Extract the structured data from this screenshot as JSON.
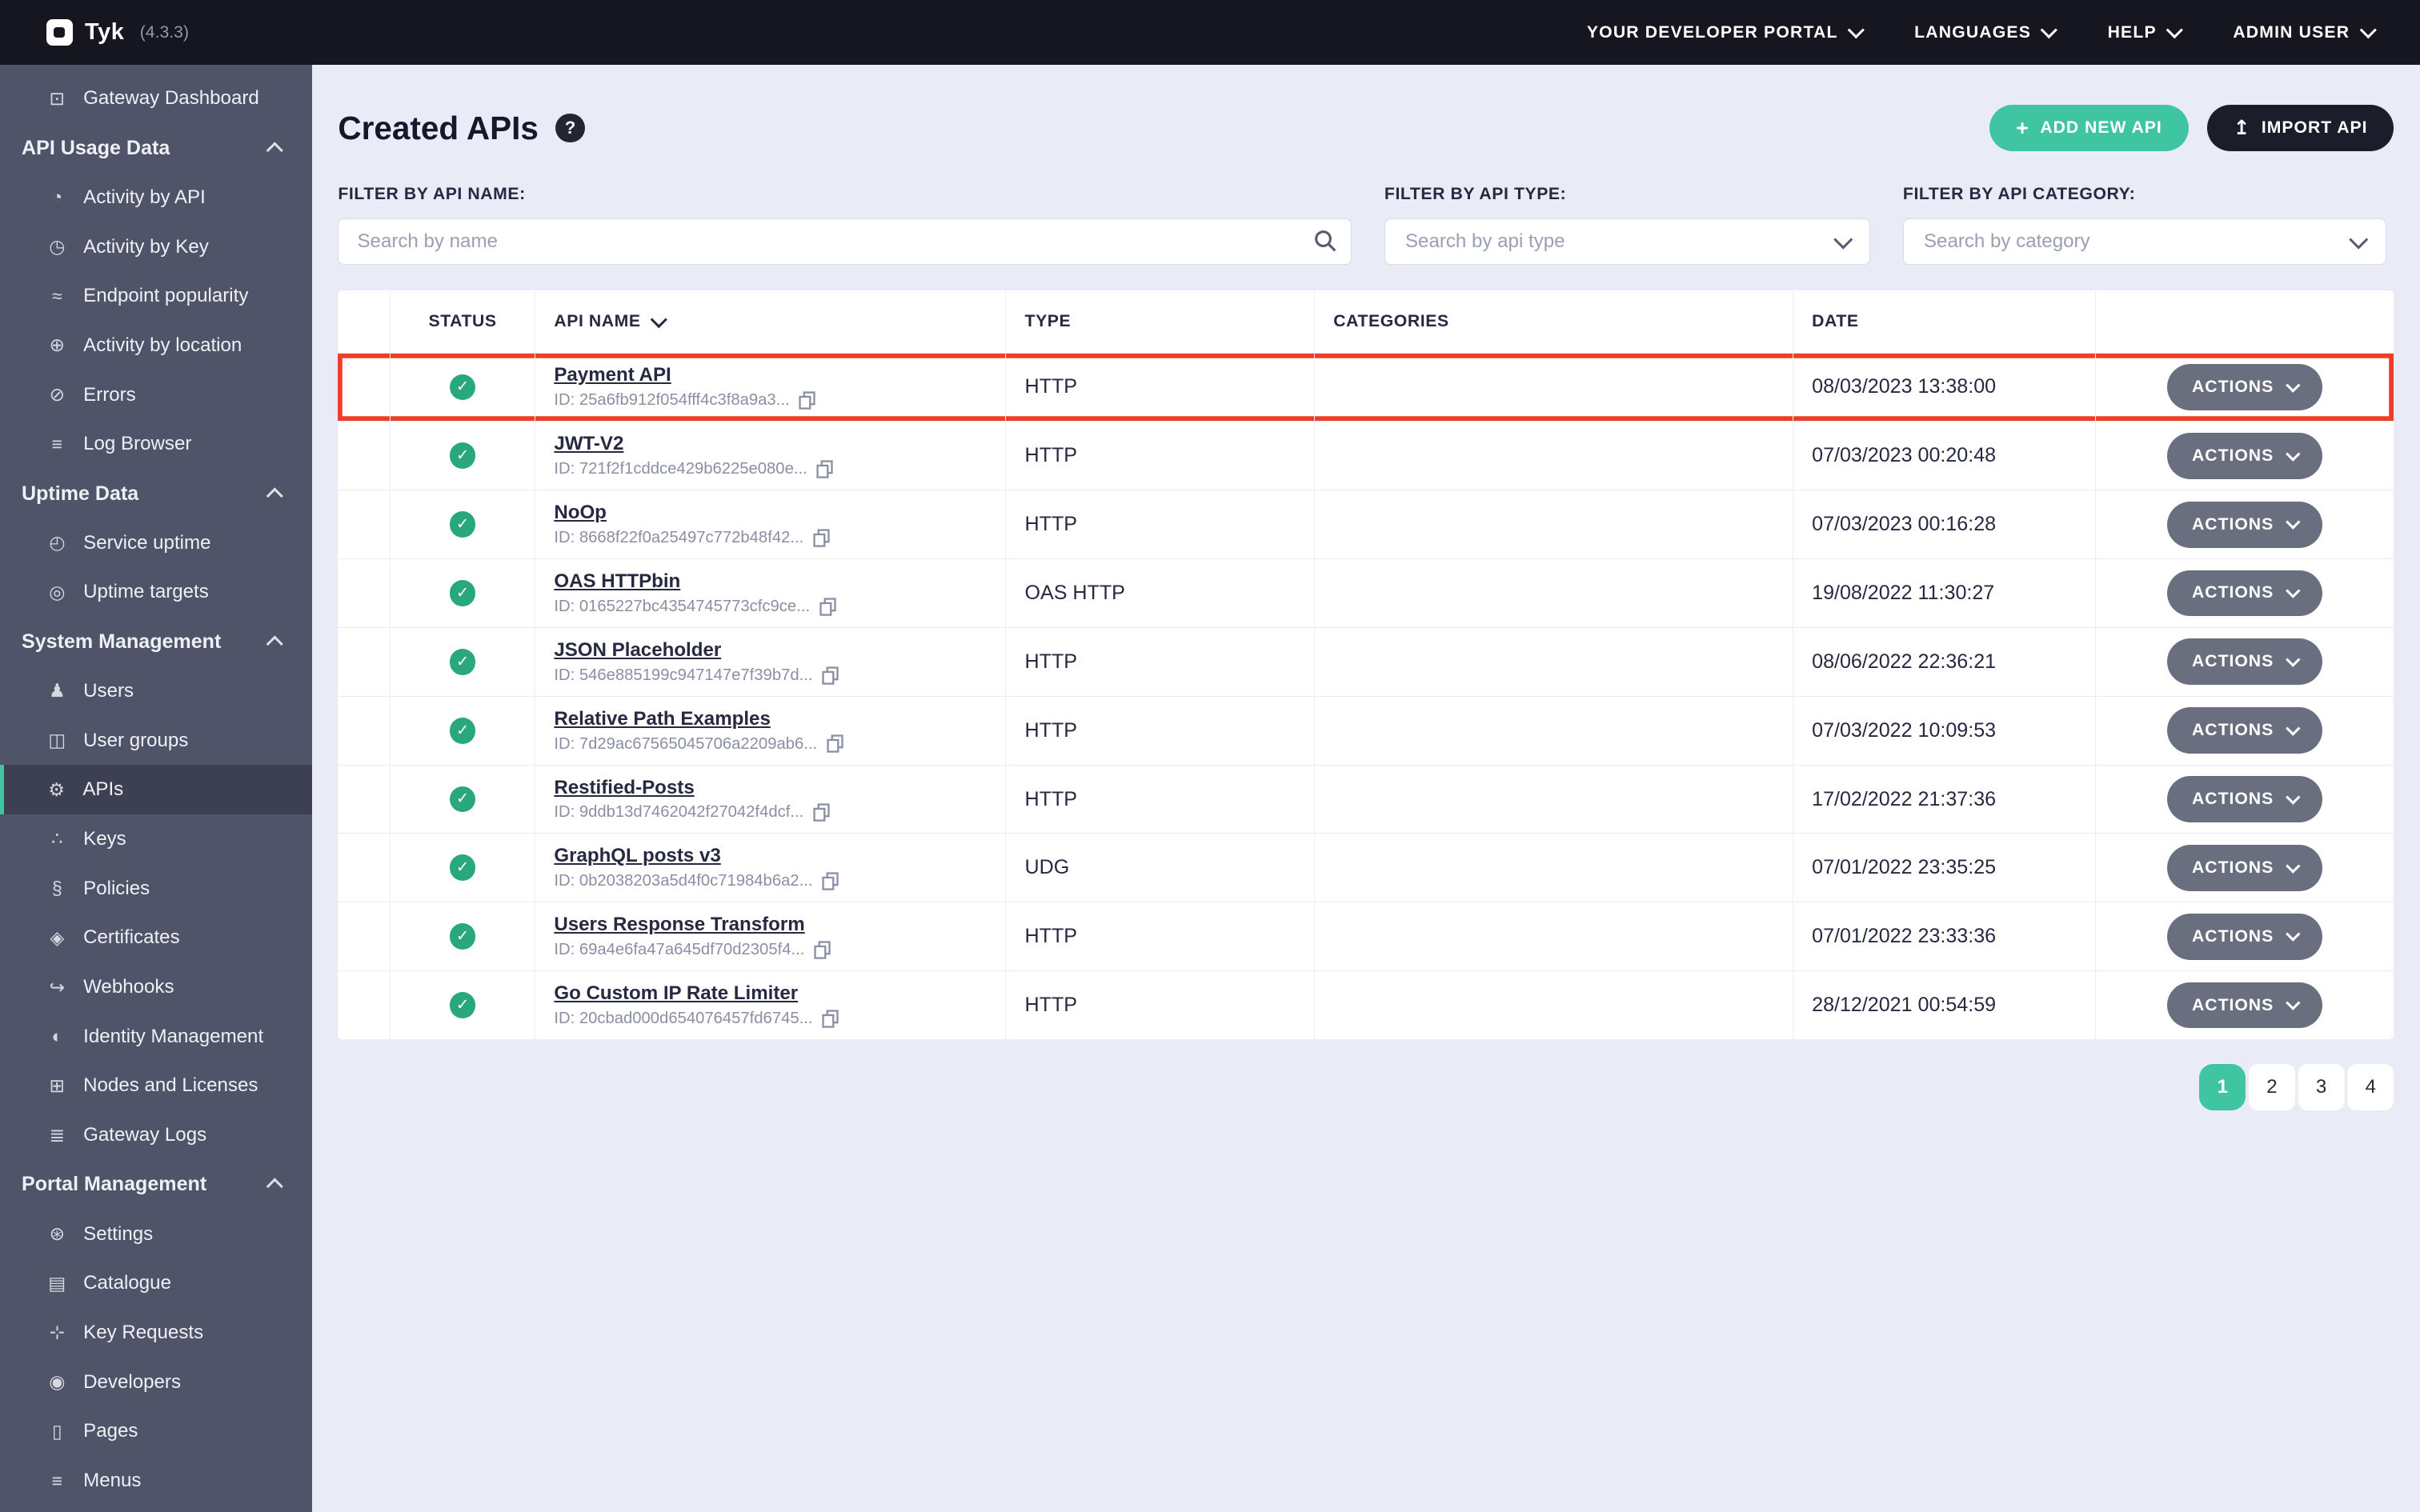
{
  "colors": {
    "accent_teal": "#3fc5a2",
    "dark_navy": "#1b1d2a",
    "status_green": "#29a87c",
    "highlight_red": "#ee3d29",
    "sidebar_bg": "#4f5468"
  },
  "topbar": {
    "logo_text": "Tyk",
    "version": "(4.3.3)",
    "menus": [
      {
        "label": "YOUR DEVELOPER PORTAL",
        "name": "menu-your-developer-portal"
      },
      {
        "label": "LANGUAGES",
        "name": "menu-languages"
      },
      {
        "label": "HELP",
        "name": "menu-help"
      },
      {
        "label": "ADMIN USER",
        "name": "menu-admin-user"
      }
    ]
  },
  "sidebar": {
    "top_items": [
      {
        "label": "Gateway Dashboard",
        "glyph": "⊡",
        "icon": "gateway-dashboard-icon",
        "name": "sidebar-item-gateway-dashboard"
      }
    ],
    "sections": [
      {
        "header": "API Usage Data",
        "name": "sidebar-section-api-usage-data",
        "items": [
          {
            "label": "Activity by API",
            "glyph": "◔",
            "icon": "activity-by-api-icon",
            "name": "sidebar-item-activity-by-api"
          },
          {
            "label": "Activity by Key",
            "glyph": "◷",
            "icon": "activity-by-key-icon",
            "name": "sidebar-item-activity-by-key"
          },
          {
            "label": "Endpoint popularity",
            "glyph": "≈",
            "icon": "endpoint-popularity-icon",
            "name": "sidebar-item-endpoint-popularity"
          },
          {
            "label": "Activity by location",
            "glyph": "⊕",
            "icon": "globe-icon",
            "name": "sidebar-item-activity-by-location"
          },
          {
            "label": "Errors",
            "glyph": "⊘",
            "icon": "errors-icon",
            "name": "sidebar-item-errors"
          },
          {
            "label": "Log Browser",
            "glyph": "≡",
            "icon": "log-browser-icon",
            "name": "sidebar-item-log-browser"
          }
        ]
      },
      {
        "header": "Uptime Data",
        "name": "sidebar-section-uptime-data",
        "items": [
          {
            "label": "Service uptime",
            "glyph": "◴",
            "icon": "service-uptime-icon",
            "name": "sidebar-item-service-uptime"
          },
          {
            "label": "Uptime targets",
            "glyph": "◎",
            "icon": "uptime-targets-icon",
            "name": "sidebar-item-uptime-targets"
          }
        ]
      },
      {
        "header": "System Management",
        "name": "sidebar-section-system-management",
        "items": [
          {
            "label": "Users",
            "glyph": "♟",
            "icon": "users-icon",
            "name": "sidebar-item-users"
          },
          {
            "label": "User groups",
            "glyph": "◫",
            "icon": "user-groups-icon",
            "name": "sidebar-item-user-groups"
          },
          {
            "label": "APIs",
            "glyph": "⚙",
            "icon": "apis-gear-icon",
            "name": "sidebar-item-apis",
            "active": true
          },
          {
            "label": "Keys",
            "glyph": "∴",
            "icon": "keys-icon",
            "name": "sidebar-item-keys"
          },
          {
            "label": "Policies",
            "glyph": "§",
            "icon": "policies-icon",
            "name": "sidebar-item-policies"
          },
          {
            "label": "Certificates",
            "glyph": "◈",
            "icon": "certificates-icon",
            "name": "sidebar-item-certificates"
          },
          {
            "label": "Webhooks",
            "glyph": "↪",
            "icon": "webhooks-icon",
            "name": "sidebar-item-webhooks"
          },
          {
            "label": "Identity Management",
            "glyph": "◐",
            "icon": "identity-management-icon",
            "name": "sidebar-item-identity-management"
          },
          {
            "label": "Nodes and Licenses",
            "glyph": "⊞",
            "icon": "nodes-licenses-icon",
            "name": "sidebar-item-nodes-and-licenses"
          },
          {
            "label": "Gateway Logs",
            "glyph": "≣",
            "icon": "gateway-logs-icon",
            "name": "sidebar-item-gateway-logs"
          }
        ]
      },
      {
        "header": "Portal Management",
        "name": "sidebar-section-portal-management",
        "items": [
          {
            "label": "Settings",
            "glyph": "⊛",
            "icon": "settings-icon",
            "name": "sidebar-item-settings"
          },
          {
            "label": "Catalogue",
            "glyph": "▤",
            "icon": "catalogue-icon",
            "name": "sidebar-item-catalogue"
          },
          {
            "label": "Key Requests",
            "glyph": "⊹",
            "icon": "key-requests-icon",
            "name": "sidebar-item-key-requests"
          },
          {
            "label": "Developers",
            "glyph": "◉",
            "icon": "developers-icon",
            "name": "sidebar-item-developers"
          },
          {
            "label": "Pages",
            "glyph": "▯",
            "icon": "pages-icon",
            "name": "sidebar-item-pages"
          },
          {
            "label": "Menus",
            "glyph": "≡",
            "icon": "menus-icon",
            "name": "sidebar-item-menus"
          }
        ]
      }
    ]
  },
  "header": {
    "title": "Created APIs",
    "help": "?",
    "add_icon": "+",
    "add_button": "ADD NEW API",
    "import_icon": "↥",
    "import_button": "IMPORT API"
  },
  "filters": {
    "name": {
      "label": "FILTER BY API NAME:",
      "placeholder": "Search by name"
    },
    "type": {
      "label": "FILTER BY API TYPE:",
      "placeholder": "Search by api type"
    },
    "category": {
      "label": "FILTER BY API CATEGORY:",
      "placeholder": "Search by category"
    }
  },
  "table": {
    "columns": {
      "status": "STATUS",
      "api_name": "API NAME",
      "type": "TYPE",
      "categories": "CATEGORIES",
      "date": "DATE"
    },
    "status_glyph": "✓",
    "actions_label": "ACTIONS",
    "rows": [
      {
        "name": "Payment API",
        "id": "ID: 25a6fb912f054fff4c3f8a9a3...",
        "type": "HTTP",
        "categories": "",
        "date": "08/03/2023 13:38:00",
        "highlighted": true
      },
      {
        "name": "JWT-V2",
        "id": "ID: 721f2f1cddce429b6225e080e...",
        "type": "HTTP",
        "categories": "",
        "date": "07/03/2023 00:20:48"
      },
      {
        "name": "NoOp",
        "id": "ID: 8668f22f0a25497c772b48f42...",
        "type": "HTTP",
        "categories": "",
        "date": "07/03/2023 00:16:28"
      },
      {
        "name": "OAS HTTPbin",
        "id": "ID: 0165227bc4354745773cfc9ce...",
        "type": "OAS HTTP",
        "categories": "",
        "date": "19/08/2022 11:30:27"
      },
      {
        "name": "JSON Placeholder",
        "id": "ID: 546e885199c947147e7f39b7d...",
        "type": "HTTP",
        "categories": "",
        "date": "08/06/2022 22:36:21"
      },
      {
        "name": "Relative Path Examples",
        "id": "ID: 7d29ac67565045706a2209ab6...",
        "type": "HTTP",
        "categories": "",
        "date": "07/03/2022 10:09:53"
      },
      {
        "name": "Restified-Posts",
        "id": "ID: 9ddb13d7462042f27042f4dcf...",
        "type": "HTTP",
        "categories": "",
        "date": "17/02/2022 21:37:36"
      },
      {
        "name": "GraphQL posts v3",
        "id": "ID: 0b2038203a5d4f0c71984b6a2...",
        "type": "UDG",
        "categories": "",
        "date": "07/01/2022 23:35:25"
      },
      {
        "name": "Users Response Transform",
        "id": "ID: 69a4e6fa47a645df70d2305f4...",
        "type": "HTTP",
        "categories": "",
        "date": "07/01/2022 23:33:36"
      },
      {
        "name": "Go Custom IP Rate Limiter",
        "id": "ID: 20cbad000d654076457fd6745...",
        "type": "HTTP",
        "categories": "",
        "date": "28/12/2021 00:54:59"
      }
    ]
  },
  "pagination": {
    "pages": [
      {
        "label": "1",
        "active": true
      },
      {
        "label": "2"
      },
      {
        "label": "3"
      },
      {
        "label": "4"
      }
    ]
  }
}
